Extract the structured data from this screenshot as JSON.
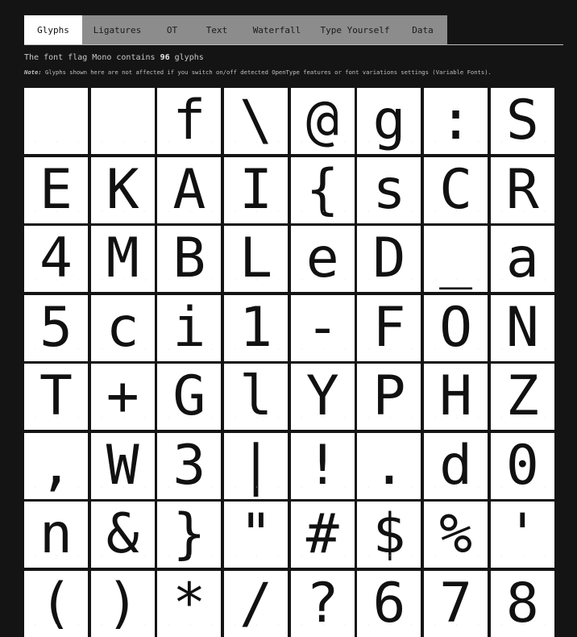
{
  "tabs": [
    {
      "label": "Glyphs",
      "active": true
    },
    {
      "label": "Ligatures",
      "active": false
    },
    {
      "label": "OT",
      "active": false
    },
    {
      "label": "Text",
      "active": false
    },
    {
      "label": "Waterfall",
      "active": false
    },
    {
      "label": "Type Yourself",
      "active": false
    },
    {
      "label": "Data",
      "active": false
    }
  ],
  "info": {
    "prefix": "The font flag Mono contains ",
    "count": "96",
    "suffix": " glyphs"
  },
  "note": {
    "label": "Note:",
    "text": " Glyphs shown here are not affected if you switch on/off detected OpenType features or font variations settings (Variable Fonts)."
  },
  "glyphs": [
    " ",
    " ",
    "f",
    "\\",
    "@",
    "g",
    ":",
    "S",
    "E",
    "K",
    "A",
    "I",
    "{",
    "s",
    "C",
    "R",
    "4",
    "M",
    "B",
    "L",
    "e",
    "D",
    "_",
    "a",
    "5",
    "c",
    "i",
    "1",
    "-",
    "F",
    "O",
    "N",
    "T",
    "+",
    "G",
    "l",
    "Y",
    "P",
    "H",
    "Z",
    ",",
    "W",
    "3",
    "|",
    "!",
    ".",
    "d",
    "0",
    "n",
    "&",
    "}",
    "\"",
    "#",
    "$",
    "%",
    "'",
    "(",
    ")",
    "*",
    "/",
    "?",
    "6",
    "7",
    "8"
  ],
  "colors": {
    "background": "#141414",
    "tab_bar": "#8c8c8c",
    "tab_active": "#ffffff",
    "cell": "#ffffff",
    "glyph": "#111111"
  }
}
